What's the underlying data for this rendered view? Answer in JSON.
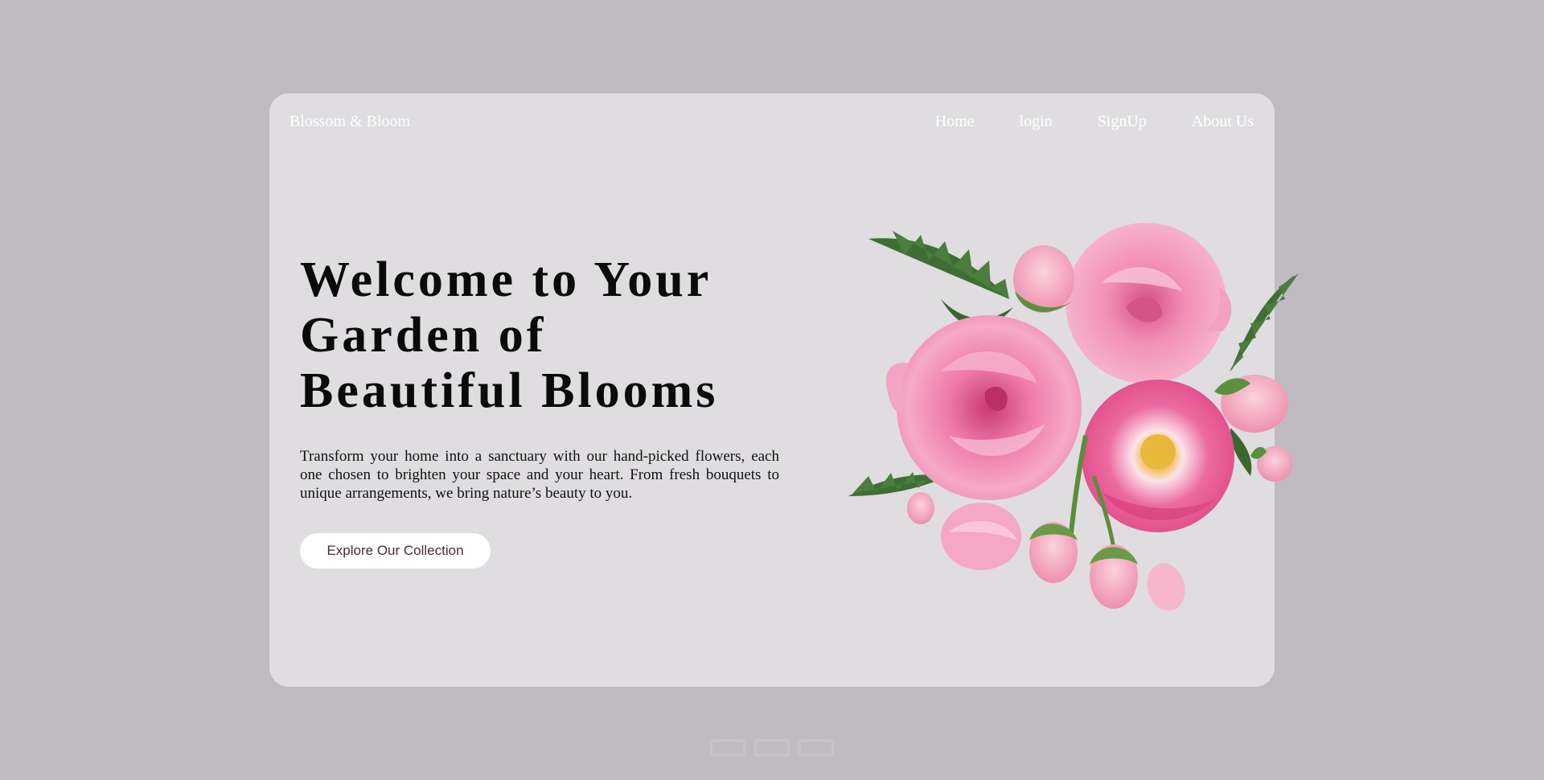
{
  "brand": {
    "name": "Blossom & Bloom"
  },
  "nav": {
    "items": [
      {
        "label": "Home"
      },
      {
        "label": "login"
      },
      {
        "label": "SignUp"
      },
      {
        "label": "About Us"
      }
    ]
  },
  "hero": {
    "title_line1": "Welcome to Your",
    "title_line2": "Garden of",
    "title_line3": "Beautiful Blooms",
    "description": "Transform your home into a sanctuary with our hand-picked flowers, each one chosen to brighten your space and your heart. From fresh bouquets to unique arrangements, we bring nature’s beauty to you.",
    "cta_label": "Explore Our Collection"
  },
  "image": {
    "icon": "pink-roses-bouquet-image"
  },
  "colors": {
    "background": "#bfbbc0",
    "card": "#dfdde0",
    "nav_text": "#ffffff",
    "title": "#0a0a0a",
    "rose_pink": "#e85f98",
    "leaf_green": "#3f6e35"
  }
}
